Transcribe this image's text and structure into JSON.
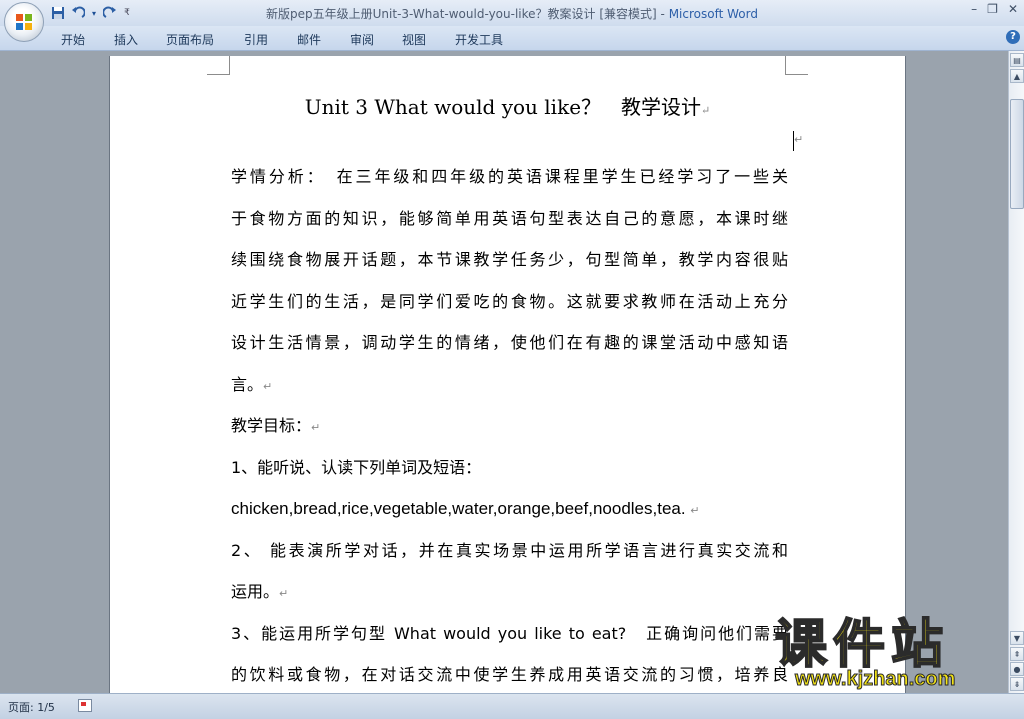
{
  "window": {
    "title_doc": "新版pep五年级上册Unit-3-What-would-you-like？教案设计 [兼容模式]",
    "title_sep": " - ",
    "title_app": "Microsoft Word"
  },
  "quick_access": {
    "icons": [
      "save-icon",
      "undo-icon",
      "redo-icon",
      "customize-dropdown-icon"
    ]
  },
  "ribbon": {
    "tabs": [
      "开始",
      "插入",
      "页面布局",
      "引用",
      "邮件",
      "审阅",
      "视图",
      "开发工具"
    ],
    "help_label": "?"
  },
  "document": {
    "title": "Unit 3 What would you like？　教学设计",
    "lines": [
      "学情分析：　在三年级和四年级的英语课程里学生已经学习了一些关",
      "于食物方面的知识，能够简单用英语句型表达自己的意愿，本课时继",
      "续围绕食物展开话题，本节课教学任务少，句型简单，教学内容很贴",
      "近学生们的生活，是同学们爱吃的食物。这就要求教师在活动上充分",
      "设计生活情景，调动学生的情绪，使他们在有趣的课堂活动中感知语",
      "言。",
      "教学目标：",
      "1、能听说、认读下列单词及短语：",
      "chicken,bread,rice,vegetable,water,orange,beef,noodles,tea.",
      "2、 能表演所学对话，并在真实场景中运用所学语言进行真实交流和",
      "运用。",
      "3、能运用所学句型 What would you like to eat?　正确询问他们需要",
      "的饮料或食物，在对话交流中使学生养成用英语交流的习惯，培养良"
    ],
    "paragraph_mark": "↵"
  },
  "status": {
    "page_label": "页面: 1/5"
  },
  "watermark": {
    "main": "课件站",
    "url": "www.kjzhan.com"
  }
}
